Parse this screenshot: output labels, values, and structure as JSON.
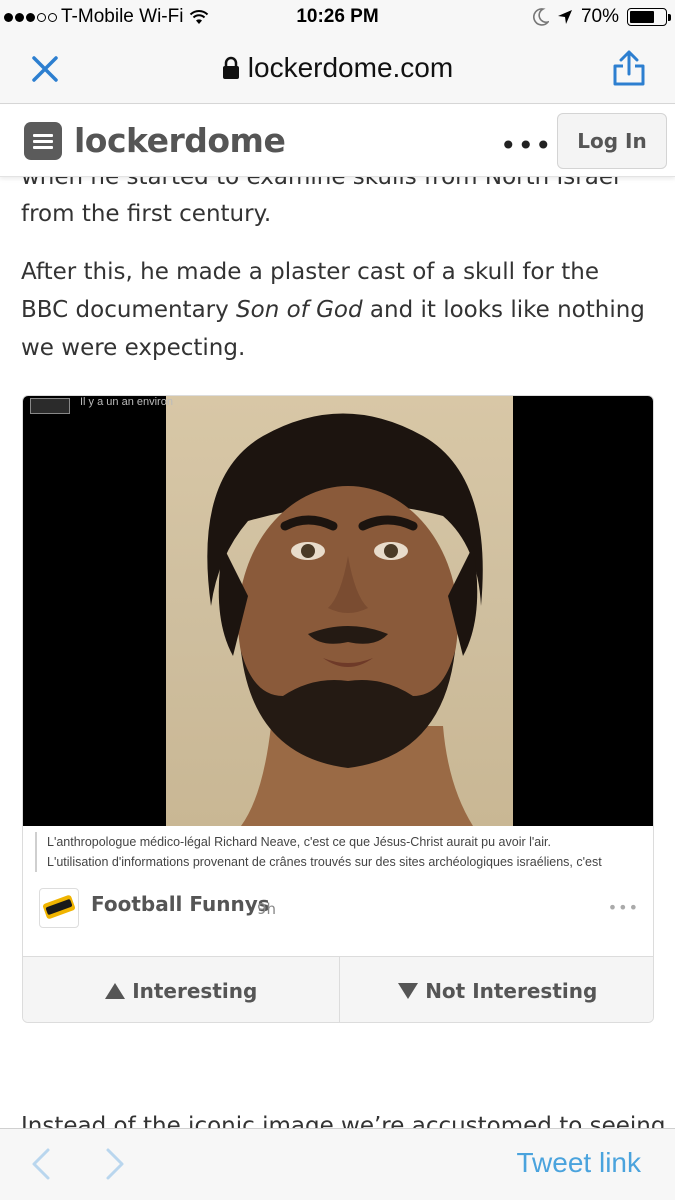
{
  "status_bar": {
    "carrier": "T-Mobile Wi-Fi",
    "time": "10:26 PM",
    "battery_percent": "70%",
    "battery_level": 0.7,
    "icons": [
      "signal-dots",
      "wifi-icon",
      "moon-icon",
      "location-arrow-icon",
      "battery-icon"
    ]
  },
  "browser": {
    "url": "lockerdome.com",
    "icons": [
      "close-icon",
      "lock-icon",
      "share-icon"
    ]
  },
  "site_header": {
    "logo_text": "lockerdome",
    "more": "•••",
    "login_label": "Log In"
  },
  "article": {
    "cut_line": "when he started to examine skulls from North Israel",
    "para1": "from the first century.",
    "para2_prefix": "After this, he made a plaster cast of a skull for the BBC documentary ",
    "para2_title": "Son of God",
    "para2_suffix": " and it looks like nothing we were expecting.",
    "next_para": "Instead of the iconic image we’re accustomed to seeing"
  },
  "embed": {
    "image_tag": "Il y a un an environ",
    "caption_line1": "L'anthropologue médico-légal Richard Neave, c'est ce que Jésus-Christ aurait pu avoir l'air.",
    "caption_line2": "L'utilisation d'informations provenant de crânes trouvés sur des sites archéologiques israéliens, c'est",
    "source_name": "Football Funnys",
    "source_time": "9h",
    "source_more": "•••",
    "vote_up_label": "Interesting",
    "vote_down_label": "Not Interesting"
  },
  "toolbar": {
    "tweet_link": "Tweet link",
    "icons": [
      "back-chevron-icon",
      "forward-chevron-icon"
    ]
  },
  "colors": {
    "link_blue": "#4aa3dd",
    "ios_blue": "#2d7fd0",
    "text": "#333333"
  }
}
